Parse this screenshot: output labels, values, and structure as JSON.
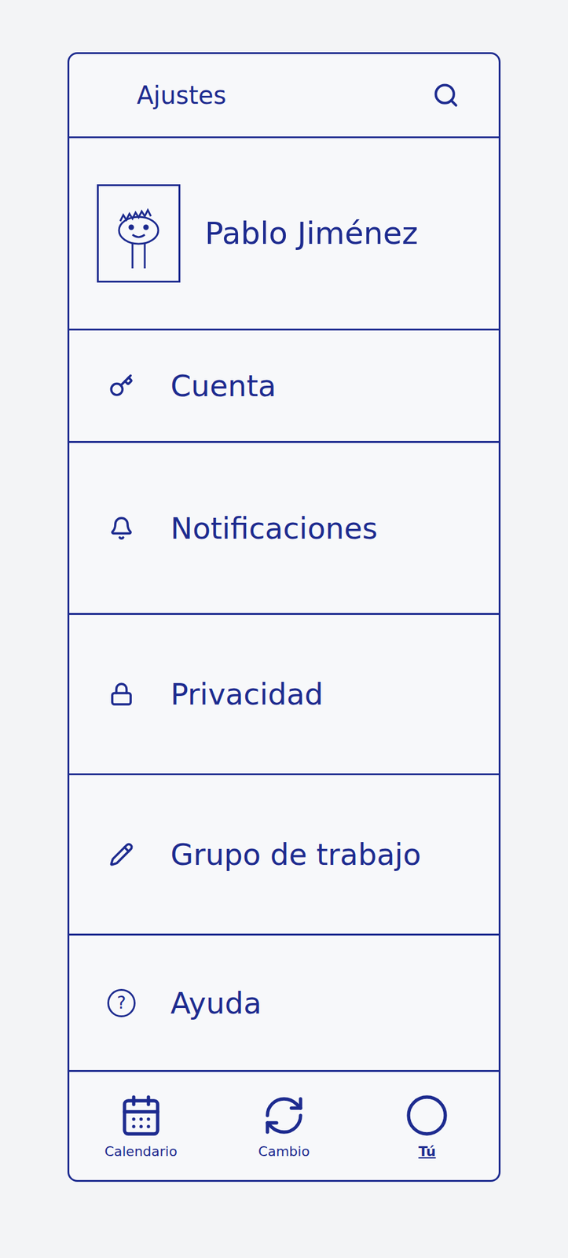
{
  "window": {
    "title": "Ajustes"
  },
  "profile": {
    "name": "Pablo Jiménez"
  },
  "items": [
    {
      "label": "Cuenta"
    },
    {
      "label": "Notificaciones"
    },
    {
      "label": "Privacidad"
    },
    {
      "label": "Grupo de trabajo"
    },
    {
      "label": "Ayuda",
      "glyph": "?"
    }
  ],
  "nav": [
    {
      "label": "Calendario",
      "selected": false
    },
    {
      "label": "Cambio",
      "selected": false
    },
    {
      "label": "Tú",
      "selected": true
    }
  ]
}
